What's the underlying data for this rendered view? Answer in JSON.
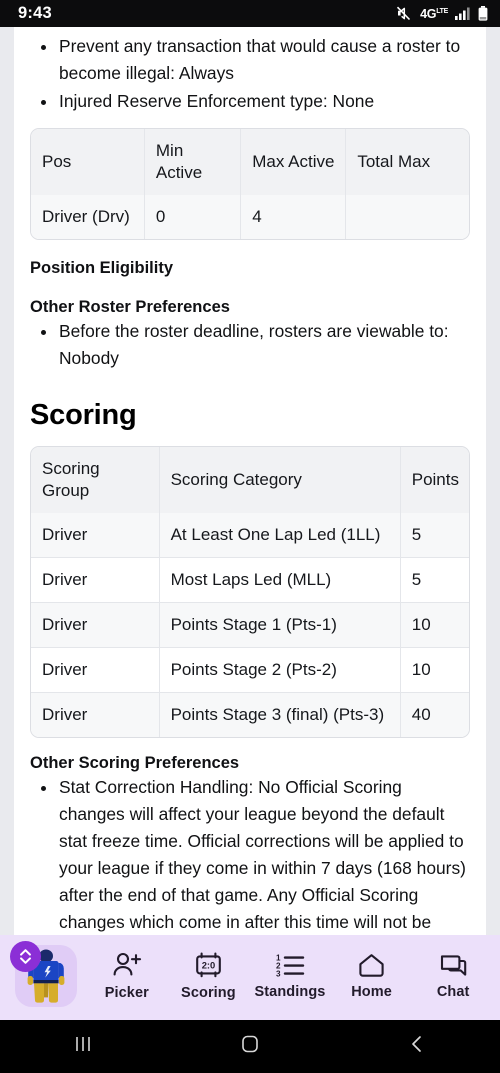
{
  "status_bar": {
    "time": "9:43",
    "network_type": "4G",
    "network_sup": "LTE",
    "icons": [
      "mute-icon",
      "network-4g-icon",
      "signal-bars-icon",
      "battery-icon"
    ]
  },
  "content": {
    "roster_rules": [
      "Prevent any transaction that would cause a roster to become illegal: Always",
      "Injured Reserve Enforcement type: None"
    ],
    "roster_table": {
      "headers": [
        "Pos",
        "Min Active",
        "Max Active",
        "Total Max"
      ],
      "rows": [
        [
          "Driver (Drv)",
          "0",
          "4",
          ""
        ]
      ]
    },
    "position_eligibility_heading": "Position Eligibility",
    "other_roster_preferences_heading": "Other Roster Preferences",
    "other_roster_preferences": [
      "Before the roster deadline, rosters are viewable to: Nobody"
    ],
    "scoring_heading": "Scoring",
    "scoring_table": {
      "headers": [
        "Scoring Group",
        "Scoring Category",
        "Points"
      ],
      "rows": [
        [
          "Driver",
          "At Least One Lap Led (1LL)",
          "5"
        ],
        [
          "Driver",
          "Most Laps Led (MLL)",
          "5"
        ],
        [
          "Driver",
          "Points Stage 1 (Pts-1)",
          "10"
        ],
        [
          "Driver",
          "Points Stage 2 (Pts-2)",
          "10"
        ],
        [
          "Driver",
          "Points Stage 3 (final) (Pts-3)",
          "40"
        ]
      ]
    },
    "other_scoring_preferences_heading": "Other Scoring Preferences",
    "other_scoring_preferences": [
      "Stat Correction Handling: No Official Scoring changes will affect your league beyond the default stat freeze time. Official corrections will be applied to your league if they come in within 7 days (168 hours) after the end of that game. Any Official Scoring changes which come in after this time will not be reflected in your league stats/scores and standings."
    ]
  },
  "bottom_nav": {
    "avatar": {
      "name": "team-avatar",
      "badge_icon": "switch-updown-icon",
      "badge_color": "#8b2fd6",
      "tile_color": "#e0ccf6"
    },
    "background_color": "#ece0fa",
    "items": [
      {
        "label": "Picker",
        "icon": "person-add-icon"
      },
      {
        "label": "Scoring",
        "icon": "scoreboard-icon",
        "icon_text": "2:0"
      },
      {
        "label": "Standings",
        "icon": "ordered-list-icon"
      },
      {
        "label": "Home",
        "icon": "home-icon"
      },
      {
        "label": "Chat",
        "icon": "chat-bubbles-icon"
      }
    ]
  },
  "system_nav": {
    "buttons": [
      {
        "name": "recents",
        "icon": "recents-icon"
      },
      {
        "name": "home",
        "icon": "home-square-icon"
      },
      {
        "name": "back",
        "icon": "back-chevron-icon"
      }
    ]
  }
}
